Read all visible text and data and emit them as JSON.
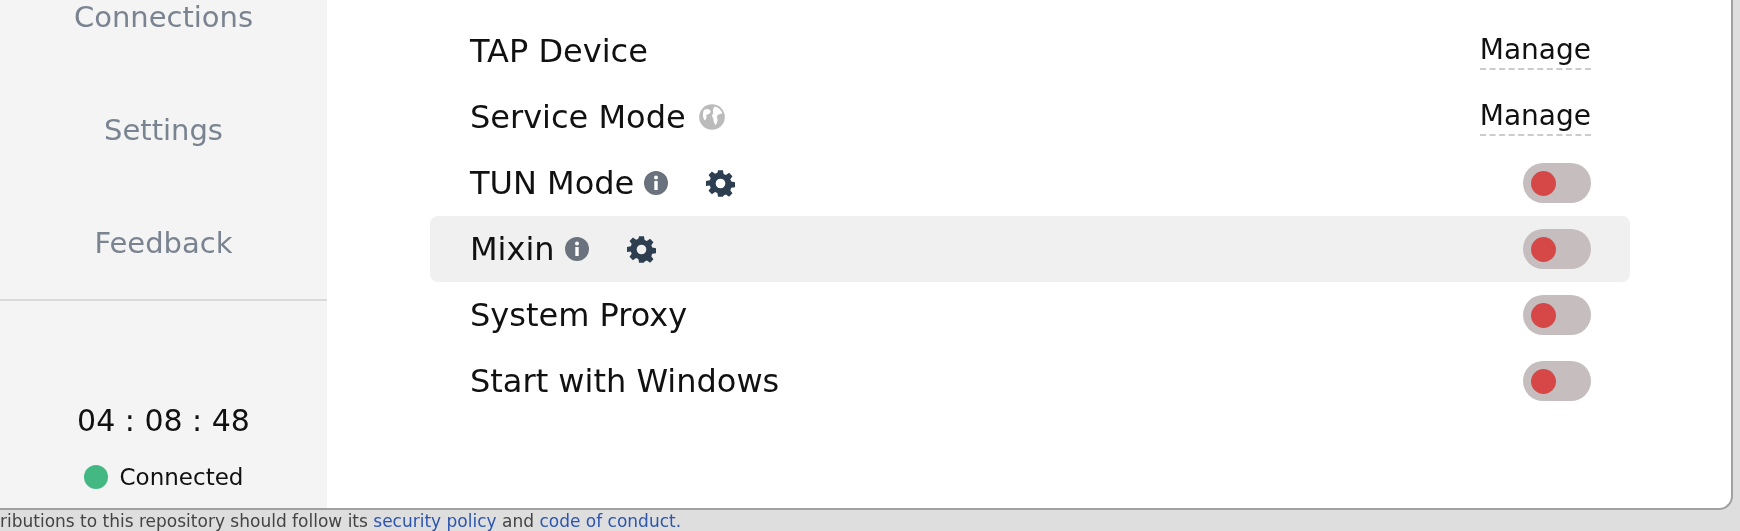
{
  "sidebar": {
    "items": [
      {
        "label": "Connections",
        "selected": false
      },
      {
        "label": "Settings",
        "selected": false
      },
      {
        "label": "Feedback",
        "selected": false
      }
    ],
    "clock": "04 : 08 : 48",
    "status": {
      "label": "Connected",
      "color": "#43b883"
    }
  },
  "settings": [
    {
      "kind": "manage",
      "label": "TAP Device",
      "action": "Manage",
      "highlighted": false
    },
    {
      "kind": "manage",
      "label": "Service Mode",
      "action": "Manage",
      "icons": [
        {
          "kind": "globe"
        }
      ],
      "highlighted": false
    },
    {
      "kind": "toggle",
      "label": "TUN Mode",
      "on": false,
      "icons": [
        {
          "kind": "info"
        },
        {
          "kind": "gear"
        }
      ],
      "highlighted": false
    },
    {
      "kind": "toggle",
      "label": "Mixin",
      "on": false,
      "icons": [
        {
          "kind": "info"
        },
        {
          "kind": "gear"
        }
      ],
      "highlighted": true
    },
    {
      "kind": "toggle",
      "label": "System Proxy",
      "on": false,
      "highlighted": false
    },
    {
      "kind": "toggle",
      "label": "Start with Windows",
      "on": false,
      "highlighted": false
    }
  ],
  "footer": [
    {
      "kind": "text",
      "text": "ributions to this repository should follow its "
    },
    {
      "kind": "link",
      "text": "security policy"
    },
    {
      "kind": "text",
      "text": " and "
    },
    {
      "kind": "link",
      "text": "code of conduct."
    }
  ]
}
